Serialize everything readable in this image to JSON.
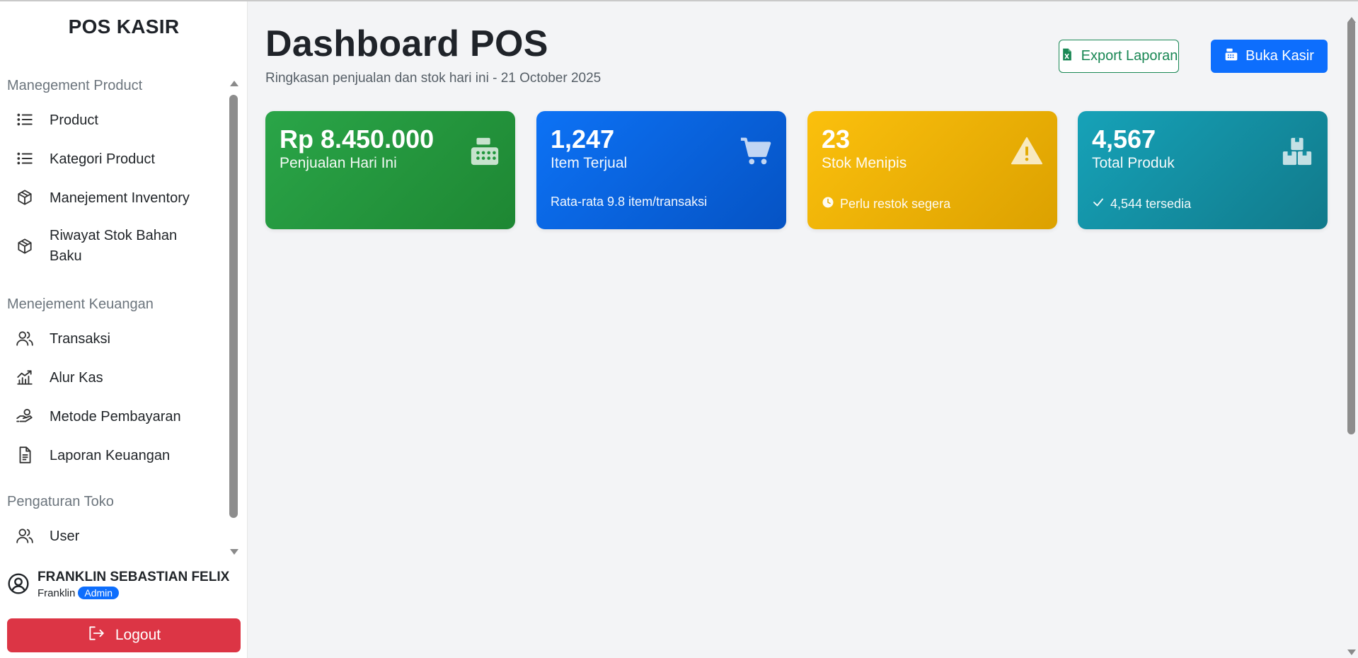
{
  "app": {
    "brand": "POS KASIR"
  },
  "sidebar": {
    "sections": [
      {
        "title": "Manegement Product"
      },
      {
        "title": "Menejement Keuangan"
      },
      {
        "title": "Pengaturan Toko"
      }
    ],
    "items": [
      {
        "label": "Product",
        "icon": "list-icon"
      },
      {
        "label": "Kategori Product",
        "icon": "list-icon"
      },
      {
        "label": "Manejement Inventory",
        "icon": "box-icon"
      },
      {
        "label": "Riwayat Stok Bahan Baku",
        "icon": "box-icon"
      },
      {
        "label": "Transaksi",
        "icon": "users-icon"
      },
      {
        "label": "Alur Kas",
        "icon": "chart-line-icon"
      },
      {
        "label": "Metode Pembayaran",
        "icon": "hand-coin-icon"
      },
      {
        "label": "Laporan Keuangan",
        "icon": "document-icon"
      },
      {
        "label": "User",
        "icon": "users-icon"
      }
    ],
    "user": {
      "full_name": "FRANKLIN SEBASTIAN FELIX",
      "username": "Franklin",
      "role": "Admin"
    },
    "logout_label": "Logout"
  },
  "header": {
    "title": "Dashboard POS",
    "subtitle": "Ringkasan penjualan dan stok hari ini - 21 October 2025",
    "export_label": "Export Laporan",
    "kasir_label": "Buka Kasir"
  },
  "cards": [
    {
      "value": "Rp 8.450.000",
      "label": "Penjualan Hari Ini",
      "icon": "cash-register-icon",
      "color": "#28a745"
    },
    {
      "value": "1,247",
      "label": "Item Terjual",
      "note": "Rata-rata 9.8 item/transaksi",
      "icon": "cart-icon",
      "color": "#0d6efd"
    },
    {
      "value": "23",
      "label": "Stok Menipis",
      "note": "Perlu restok segera",
      "icon": "warning-icon",
      "color": "#ffc107"
    },
    {
      "value": "4,567",
      "label": "Total Produk",
      "note": "4,544 tersedia",
      "icon": "boxes-icon",
      "color": "#17a2b8"
    }
  ]
}
